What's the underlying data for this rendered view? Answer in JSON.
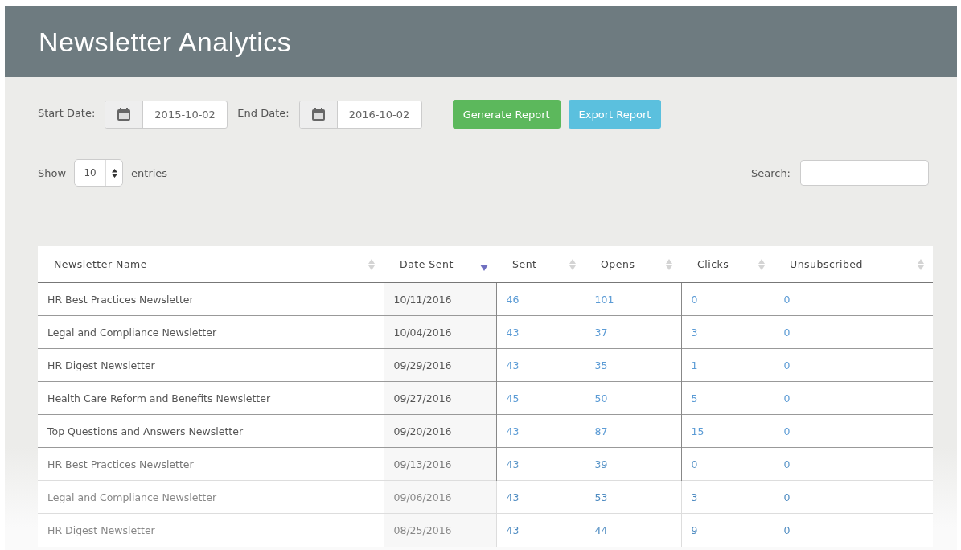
{
  "header": {
    "title": "Newsletter Analytics"
  },
  "filters": {
    "start_label": "Start Date:",
    "start_value": "2015-10-02",
    "end_label": "End Date:",
    "end_value": "2016-10-02",
    "buttons": [
      {
        "label": "Generate Report",
        "kind": "success"
      },
      {
        "label": "Export Report",
        "kind": "info"
      }
    ]
  },
  "length": {
    "show_label": "Show",
    "value": "10",
    "entries_label": "entries"
  },
  "search": {
    "label": "Search:"
  },
  "table": {
    "columns": [
      {
        "label": "Newsletter Name",
        "sorted": false
      },
      {
        "label": "Date Sent",
        "sorted": true
      },
      {
        "label": "Sent",
        "sorted": false
      },
      {
        "label": "Opens",
        "sorted": false
      },
      {
        "label": "Clicks",
        "sorted": false
      },
      {
        "label": "Unsubscribed",
        "sorted": false
      }
    ],
    "rows": [
      [
        "HR Best Practices Newsletter",
        "10/11/2016",
        "46",
        "101",
        "0",
        "0"
      ],
      [
        "Legal and Compliance Newsletter",
        "10/04/2016",
        "43",
        "37",
        "3",
        "0"
      ],
      [
        "HR Digest Newsletter",
        "09/29/2016",
        "43",
        "35",
        "1",
        "0"
      ],
      [
        "Health Care Reform and Benefits Newsletter",
        "09/27/2016",
        "45",
        "50",
        "5",
        "0"
      ],
      [
        "Top Questions and Answers Newsletter",
        "09/20/2016",
        "43",
        "87",
        "15",
        "0"
      ],
      [
        "HR Best Practices Newsletter",
        "09/13/2016",
        "43",
        "39",
        "0",
        "0"
      ],
      [
        "Legal and Compliance Newsletter",
        "09/06/2016",
        "43",
        "53",
        "3",
        "0"
      ],
      [
        "HR Digest Newsletter",
        "08/25/2016",
        "43",
        "44",
        "9",
        "0"
      ]
    ]
  }
}
